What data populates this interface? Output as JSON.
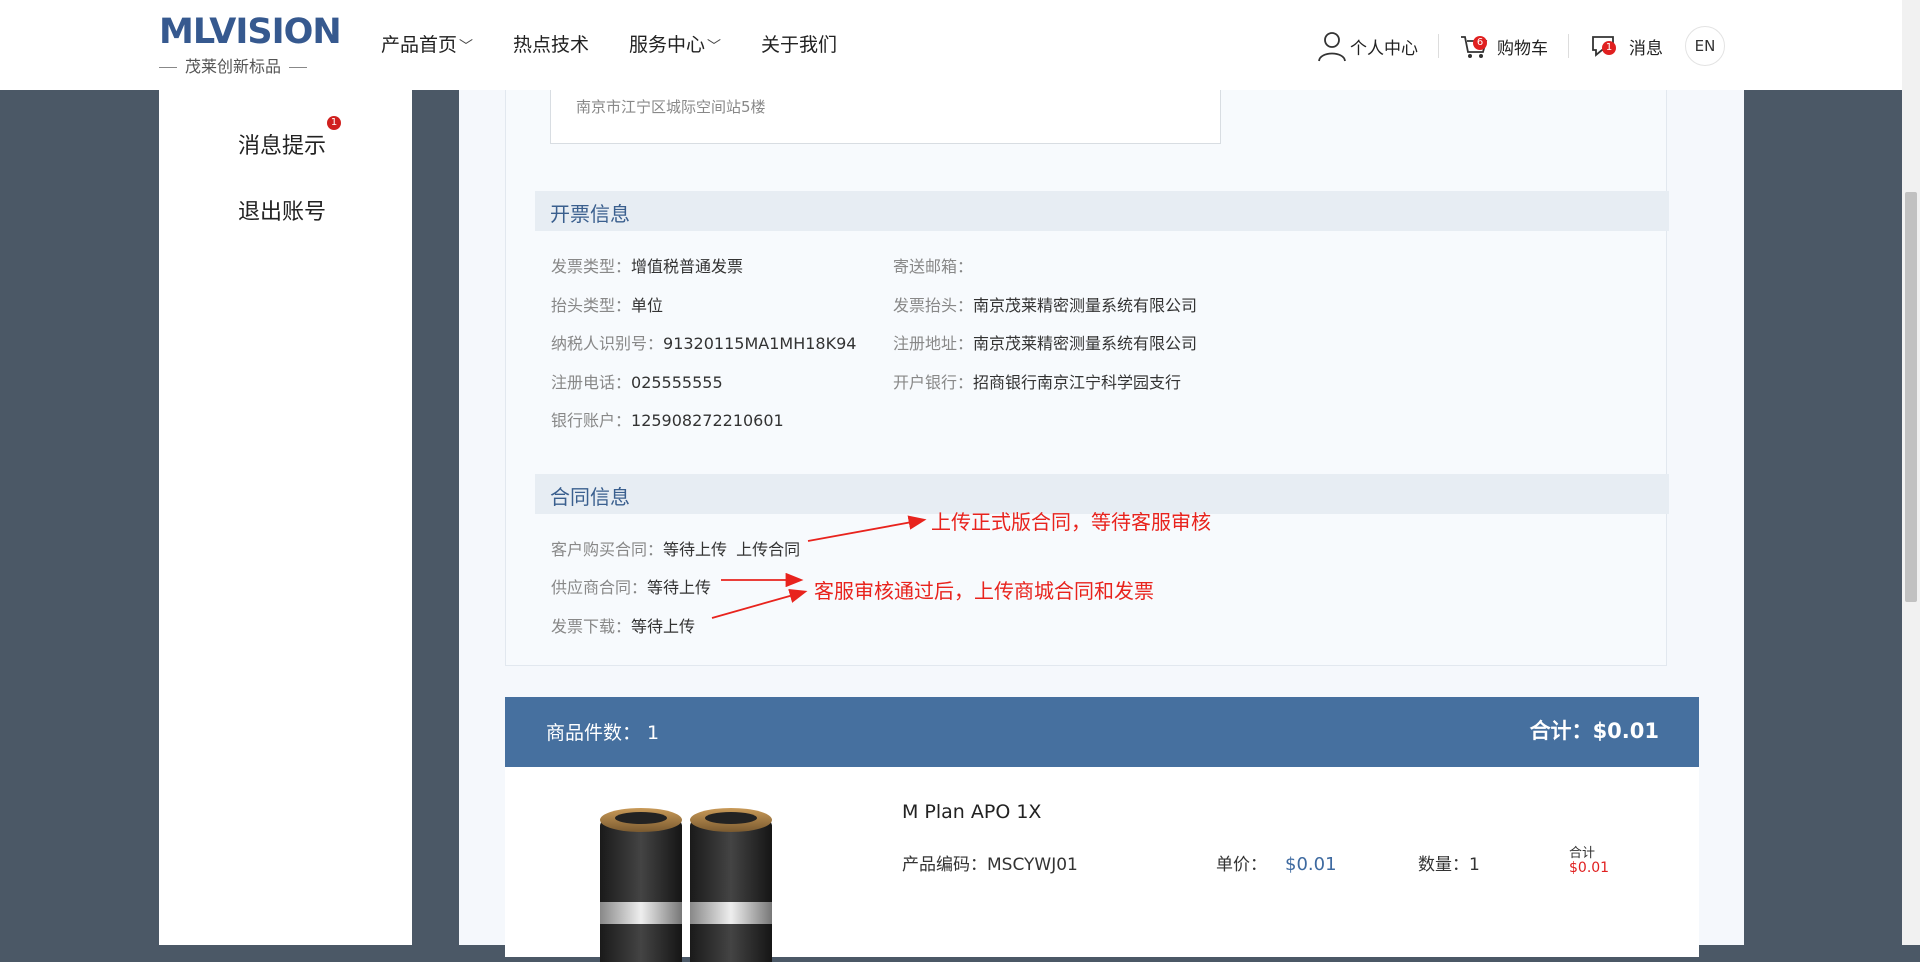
{
  "header": {
    "logo_main": "MLVISION",
    "logo_sub": "茂莱创新标品",
    "nav": [
      {
        "label": "产品首页",
        "has_dropdown": true
      },
      {
        "label": "热点技术",
        "has_dropdown": false
      },
      {
        "label": "服务中心",
        "has_dropdown": true
      },
      {
        "label": "关于我们",
        "has_dropdown": false
      }
    ],
    "user_center": "个人中心",
    "cart": "购物车",
    "cart_count": "6",
    "messages": "消息",
    "message_count": "1",
    "lang": "EN"
  },
  "sidebar": {
    "items": [
      {
        "label": "消息提示",
        "badge": "1"
      },
      {
        "label": "退出账号"
      }
    ]
  },
  "address": {
    "line": "南京市江宁区城际空间站5楼"
  },
  "invoice": {
    "title": "开票信息",
    "fields": [
      {
        "k": "发票类型：",
        "v": "增值税普通发票"
      },
      {
        "k": "寄送邮箱：",
        "v": ""
      },
      {
        "k": "抬头类型：",
        "v": "单位"
      },
      {
        "k": "发票抬头：",
        "v": "南京茂莱精密测量系统有限公司"
      },
      {
        "k": "纳税人识别号：",
        "v": "91320115MA1MH18K94"
      },
      {
        "k": "注册地址：",
        "v": "南京茂莱精密测量系统有限公司"
      },
      {
        "k": "注册电话：",
        "v": "025555555"
      },
      {
        "k": "开户银行：",
        "v": "招商银行南京江宁科学园支行"
      },
      {
        "k": "银行账户：",
        "v": "125908272210601"
      }
    ]
  },
  "contract": {
    "title": "合同信息",
    "customer": {
      "k": "客户购买合同：",
      "v": "等待上传",
      "action": "上传合同"
    },
    "supplier": {
      "k": "供应商合同：",
      "v": "等待上传"
    },
    "invoice_dl": {
      "k": "发票下载：",
      "v": "等待上传"
    },
    "annotation1": "上传正式版合同，等待客服审核",
    "annotation2": "客服审核通过后，上传商城合同和发票"
  },
  "order": {
    "count_label": "商品件数：",
    "count": "1",
    "total_label": "合计：",
    "total": "$0.01",
    "product": {
      "name": "M Plan APO 1X",
      "code_label": "产品编码：",
      "code": "MSCYWJ01",
      "price_label": "单价：",
      "price": "$0.01",
      "qty_label": "数量：",
      "qty": "1",
      "subtotal_label": "合计",
      "subtotal": "$0.01"
    }
  },
  "colors": {
    "accent": "#46709f",
    "annotation": "#e8231d",
    "page_bg": "#4b5866"
  }
}
